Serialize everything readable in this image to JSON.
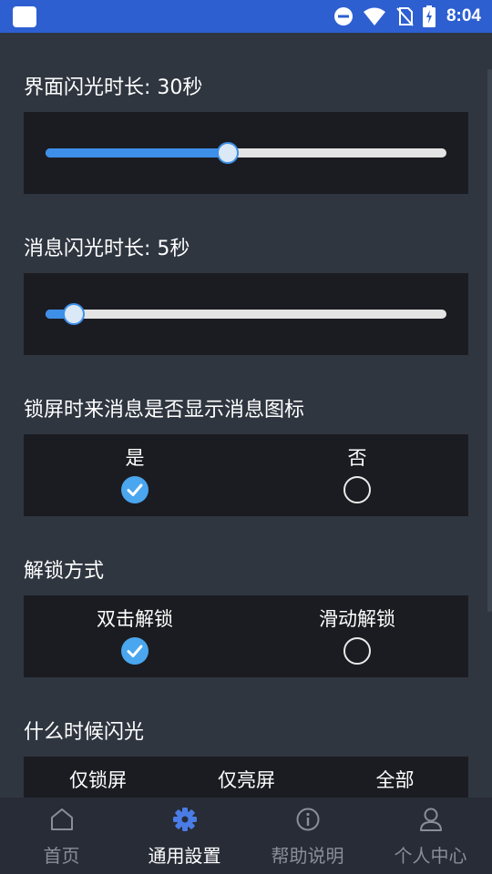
{
  "status": {
    "time": "8:04"
  },
  "settings": {
    "screen_flash": {
      "label": "界面闪光时长: 30秒",
      "fill_fraction": 0.455
    },
    "message_flash": {
      "label": "消息闪光时长: 5秒",
      "fill_fraction": 0.07
    },
    "lockscreen_icon": {
      "label": "锁屏时来消息是否显示消息图标",
      "options": [
        {
          "label": "是",
          "selected": true
        },
        {
          "label": "否",
          "selected": false
        }
      ]
    },
    "unlock_method": {
      "label": "解锁方式",
      "options": [
        {
          "label": "双击解锁",
          "selected": true
        },
        {
          "label": "滑动解锁",
          "selected": false
        }
      ]
    },
    "flash_when": {
      "label": "什么时候闪光",
      "options": [
        {
          "label": "仅锁屏"
        },
        {
          "label": "仅亮屏"
        },
        {
          "label": "全部"
        }
      ]
    }
  },
  "nav": [
    {
      "label": "首页",
      "icon": "home-icon",
      "active": false
    },
    {
      "label": "通用設置",
      "icon": "gear-icon",
      "active": true
    },
    {
      "label": "帮助说明",
      "icon": "info-icon",
      "active": false
    },
    {
      "label": "个人中心",
      "icon": "user-icon",
      "active": false
    }
  ],
  "colors": {
    "accent": "#3d8fe8",
    "status_bar": "#2d5fd1",
    "background": "#2f3640",
    "panel": "#1b1c21",
    "nav_bg": "#282c37"
  }
}
